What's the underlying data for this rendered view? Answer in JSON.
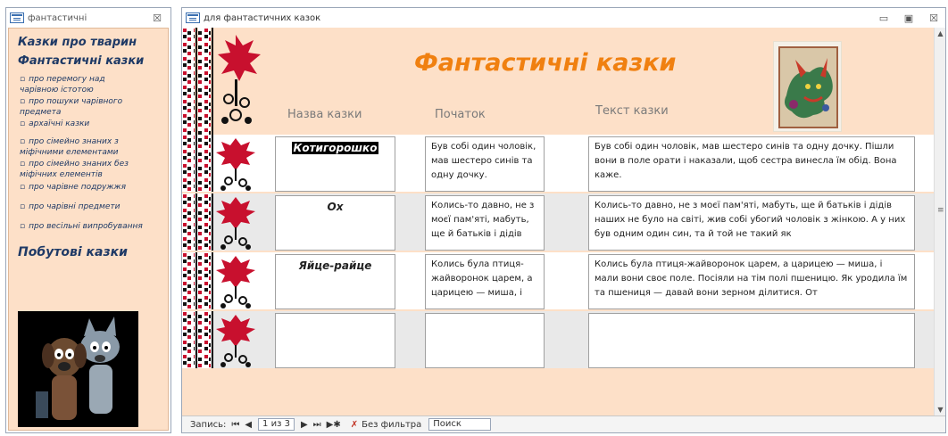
{
  "left_form": {
    "title": "фантастичні",
    "close_glyph": "☒",
    "categories": [
      {
        "label": "Казки про тварин"
      },
      {
        "label": "Фантастичні казки"
      },
      {
        "label": "Побутові казки"
      }
    ],
    "subitems": [
      "про перемогу над чарівною істотою",
      "про пошуки чарівного предмета",
      "архаїчні казки",
      "про сімейно знаних з міфічними елементами",
      "про сімейно знаних без міфічних елементів",
      "про чарівне подружжя",
      "про чарівні предмети",
      "про весільні випробування"
    ],
    "bullet": "▫"
  },
  "main_form": {
    "title": "для фантастичних казок",
    "form_heading": "Фантастичні казки",
    "column_labels": {
      "name": "Назва казки",
      "start": "Початок",
      "text": "Текст казки"
    },
    "records": [
      {
        "name": "Котигорошко",
        "start": "Був собі один чоловік, мав шестеро синів та одну дочку.",
        "text": "Був собі один чоловік, мав шестеро синів та одну дочку. Пішли вони в поле орати і наказали, щоб сестра винесла їм обід. Вона каже."
      },
      {
        "name": "Ох",
        "start": "Колись-то давно, не з моєї пам'яті, мабуть, ще й батьків і дідів",
        "text": "Колись-то давно, не з моєї пам'яті, мабуть, ще й батьків і дідів наших не було на світі, жив собі убогий чоловік з жінкою. А у них був одним один син, та й той не такий як"
      },
      {
        "name": "Яйце-райце",
        "start": "Колись була птиця-жайворонок царем, а царицею — миша, і",
        "text": "Колись була птиця-жайворонок царем, а царицею — миша, і мали вони своє поле. Посіяли на тім полі пшеницю. Як уродила їм та пшениця — давай вони зерном ділитися. От"
      },
      {
        "name": "",
        "start": "",
        "text": ""
      }
    ]
  },
  "navbar": {
    "record_label": "Запись:",
    "first": "⏮",
    "prev": "◀",
    "record_position": "1 из 3",
    "next": "▶",
    "last": "⏭",
    "new": "▶✱",
    "filter_label": "Без фильтра",
    "search_placeholder": "Поиск"
  },
  "colors": {
    "form_background": "#fde0c8",
    "heading_orange": "#f08010",
    "category_blue": "#1f3a66",
    "ornament_red": "#c8102e",
    "ornament_black": "#111111"
  }
}
